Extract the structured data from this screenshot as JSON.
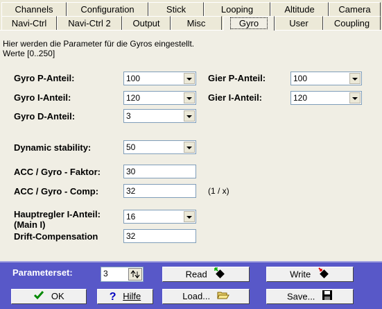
{
  "tabs_row1": [
    "Channels",
    "Configuration",
    "Stick",
    "Looping",
    "Altitude",
    "Camera"
  ],
  "tabs_row2": [
    "Navi-Ctrl",
    "Navi-Ctrl 2",
    "Output",
    "Misc",
    "Gyro",
    "User",
    "Coupling"
  ],
  "active_tab": "Gyro",
  "description": "Hier werden die Parameter für die Gyros eingestellt.",
  "range_note": "Werte [0..250]",
  "fields": {
    "gyro_p": {
      "label": "Gyro P-Anteil:",
      "value": "100"
    },
    "gyro_i": {
      "label": "Gyro I-Anteil:",
      "value": "120"
    },
    "gyro_d": {
      "label": "Gyro D-Anteil:",
      "value": "3"
    },
    "gier_p": {
      "label": "Gier P-Anteil:",
      "value": "100"
    },
    "gier_i": {
      "label": "Gier I-Anteil:",
      "value": "120"
    },
    "dynamic_stability": {
      "label": "Dynamic stability:",
      "value": "50"
    },
    "acc_gyro_faktor": {
      "label": "ACC / Gyro - Faktor:",
      "value": "30"
    },
    "acc_gyro_comp": {
      "label": "ACC / Gyro - Comp:",
      "value": "32",
      "unit": "(1 / x)"
    },
    "hauptregler": {
      "label": "Hauptregler I-Anteil:",
      "label2": "(Main I)",
      "value": "16"
    },
    "drift": {
      "label": "Drift-Compensation",
      "value": "32"
    }
  },
  "footer": {
    "parameterset_label": "Parameterset:",
    "parameterset_value": "3",
    "read_label": "Read",
    "write_label": "Write",
    "ok_label": "OK",
    "help_label": "Hilfe",
    "load_label": "Load...",
    "save_label": "Save..."
  }
}
